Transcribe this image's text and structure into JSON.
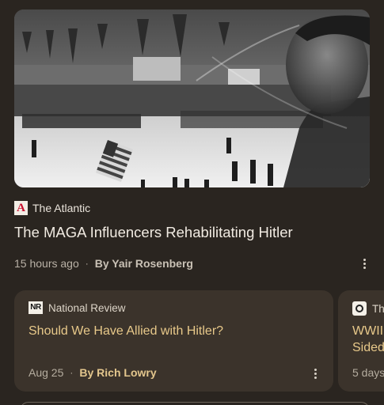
{
  "main_article": {
    "publisher": "The Atlantic",
    "publisher_logo_letter": "A",
    "headline": "The MAGA Influencers Rehabilitating Hitler",
    "time": "15 hours ago",
    "separator": "·",
    "author": "By Yair Rosenberg"
  },
  "cards": [
    {
      "publisher": "National Review",
      "logo_text": "NR",
      "title": "Should We Have Allied with Hitler?",
      "date": "Aug 25",
      "separator": "·",
      "author": "By Rich Lowry"
    },
    {
      "publisher": "The",
      "title": "WWII Sided",
      "date": "5 days"
    }
  ],
  "colors": {
    "background": "#2a2520",
    "card": "#3b332b",
    "card_title": "#e8c98a",
    "atlantic_red": "#c8102e"
  },
  "icons": [
    "more-vert-icon"
  ]
}
